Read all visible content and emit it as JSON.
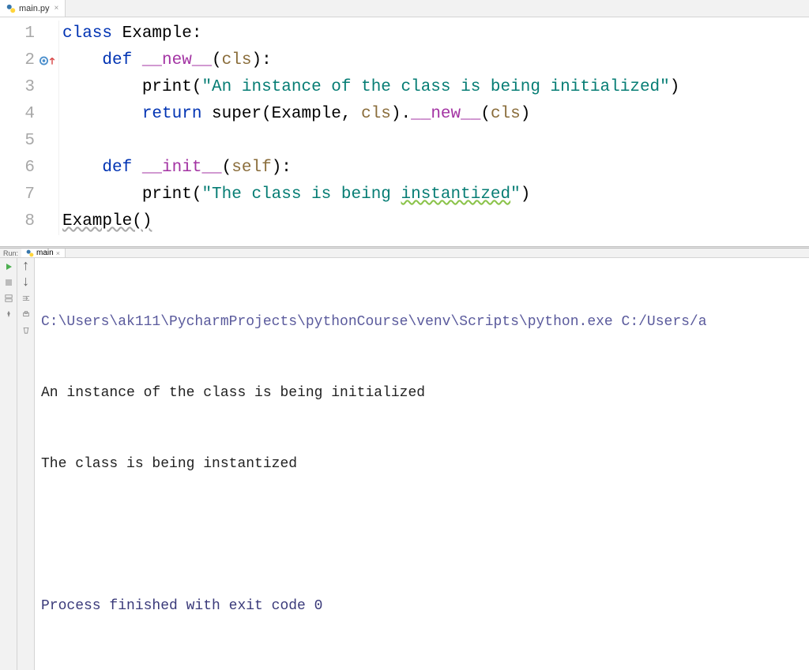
{
  "editor": {
    "tab": {
      "filename": "main.py"
    },
    "lines": {
      "1": {
        "n": "1"
      },
      "2": {
        "n": "2"
      },
      "3": {
        "n": "3"
      },
      "4": {
        "n": "4"
      },
      "5": {
        "n": "5"
      },
      "6": {
        "n": "6"
      },
      "7": {
        "n": "7"
      },
      "8": {
        "n": "8"
      }
    },
    "code": {
      "l1": {
        "kw_class": "class",
        "name": " Example:"
      },
      "l2": {
        "kw_def": "    def ",
        "fn": "__new__",
        "open": "(",
        "param": "cls",
        "close": "):"
      },
      "l3": {
        "indent": "        ",
        "print": "print",
        "open": "(",
        "str": "\"An instance of the class is being initialized\"",
        "close": ")"
      },
      "l4": {
        "indent": "        ",
        "kw_return": "return ",
        "super": "super",
        "open1": "(Example, ",
        "param": "cls",
        "close1": ").",
        "fn": "__new__",
        "open2": "(",
        "param2": "cls",
        "close2": ")"
      },
      "l5": {
        "blank": ""
      },
      "l6": {
        "kw_def": "    def ",
        "fn": "__init__",
        "open": "(",
        "param": "self",
        "close": "):"
      },
      "l7": {
        "indent": "        ",
        "print": "print",
        "open": "(",
        "str_a": "\"The class is being ",
        "str_b": "instantized",
        "str_c": "\"",
        "close": ")"
      },
      "l8": {
        "call": "Example()"
      }
    }
  },
  "run": {
    "label": "Run:",
    "tab": "main",
    "output": {
      "cmd": "C:\\Users\\ak111\\PycharmProjects\\pythonCourse\\venv\\Scripts\\python.exe C:/Users/a",
      "line1": "An instance of the class is being initialized",
      "line2": "The class is being instantized",
      "status": "Process finished with exit code 0"
    }
  }
}
